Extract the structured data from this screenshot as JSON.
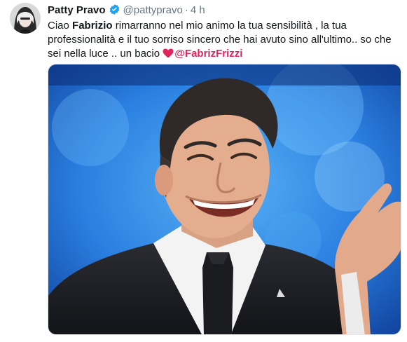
{
  "tweet": {
    "author_name": "Patty Pravo",
    "handle": "@pattypravo",
    "separator": "·",
    "time": "4 h",
    "text_part1": "Ciao ",
    "text_bold": "Fabrizio",
    "text_part2": " rimarranno nel mio animo la tua sensibilità , la tua professionalità e il tuo sorriso sincero che hai avuto sino all'ultimo.. so che sei nella luce .. un bacio ",
    "mention": "@FabrizFrizzi"
  },
  "icons": {
    "verified": "verified-badge-icon",
    "heart": "red-heart-emoji-icon"
  },
  "colors": {
    "verified": "#1da1f2",
    "heart": "#e0245e",
    "mention": "#e0245e",
    "secondary_text": "#657786",
    "stage_blue": "#1e6fd9"
  }
}
